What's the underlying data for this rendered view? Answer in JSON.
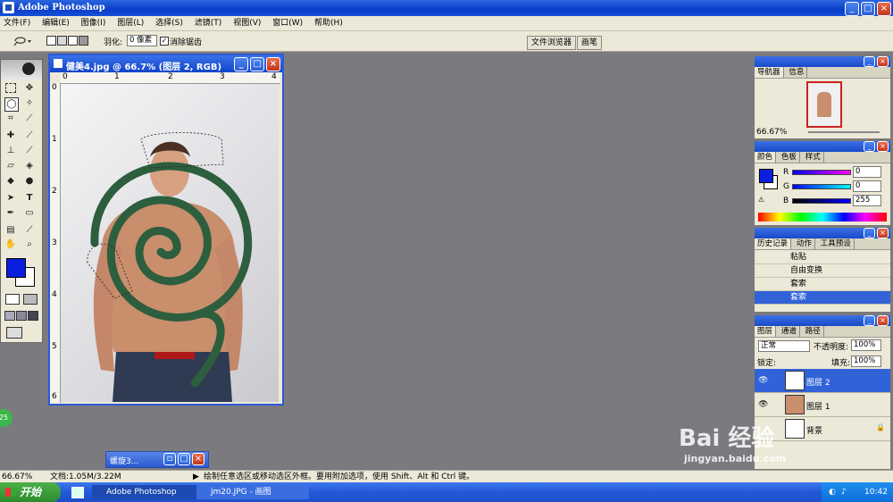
{
  "titlebar": {
    "title": "Adobe Photoshop"
  },
  "menu": [
    "文件(F)",
    "编辑(E)",
    "图像(I)",
    "图层(L)",
    "选择(S)",
    "滤镜(T)",
    "视图(V)",
    "窗口(W)",
    "帮助(H)"
  ],
  "options": {
    "feather_label": "羽化:",
    "feather_value": "0 像素",
    "antialias_label": "消除锯齿"
  },
  "wells": {
    "file_browser": "文件浏览器",
    "brushes": "画笔"
  },
  "document": {
    "title": "健美4.jpg @ 66.7% (图层 2, RGB)",
    "ruler_h": [
      "0",
      "1",
      "2",
      "3",
      "4"
    ],
    "ruler_v": [
      "0",
      "1",
      "2",
      "3",
      "4",
      "5",
      "6"
    ]
  },
  "navigator": {
    "tabs": [
      "导航器",
      "信息"
    ],
    "zoom": "66.67%"
  },
  "color": {
    "tabs": [
      "颜色",
      "色板",
      "样式"
    ],
    "r_label": "R",
    "g_label": "G",
    "b_label": "B",
    "r": "0",
    "g": "0",
    "b": "255",
    "foreground": "#0a1ee0"
  },
  "history": {
    "tabs": [
      "历史记录",
      "动作",
      "工具预设"
    ],
    "items": [
      "粘贴",
      "自由变换",
      "套索",
      "套索"
    ]
  },
  "layers": {
    "tabs": [
      "图层",
      "通道",
      "路径"
    ],
    "blend_mode": "正常",
    "opacity_label": "不透明度:",
    "opacity": "100%",
    "lock_label": "锁定:",
    "fill_label": "填充:",
    "fill": "100%",
    "items": [
      "图层 2",
      "图层 1",
      "背景"
    ]
  },
  "floating_palette": {
    "title": "螺旋3..."
  },
  "statusbar": {
    "zoom": "66.67%",
    "doc": "文档:1.05M/3.22M",
    "hint": "绘制任意选区或移动选区外框。要用附加选项，使用 Shift、Alt 和 Ctrl 键。"
  },
  "taskbar": {
    "start": "开始",
    "items": [
      "Adobe Photoshop",
      "jm20.JPG - 画图"
    ],
    "time": "10:42"
  },
  "badge": "25",
  "watermark": {
    "brand": "Bai 经验",
    "url": "jingyan.baidu.com"
  }
}
